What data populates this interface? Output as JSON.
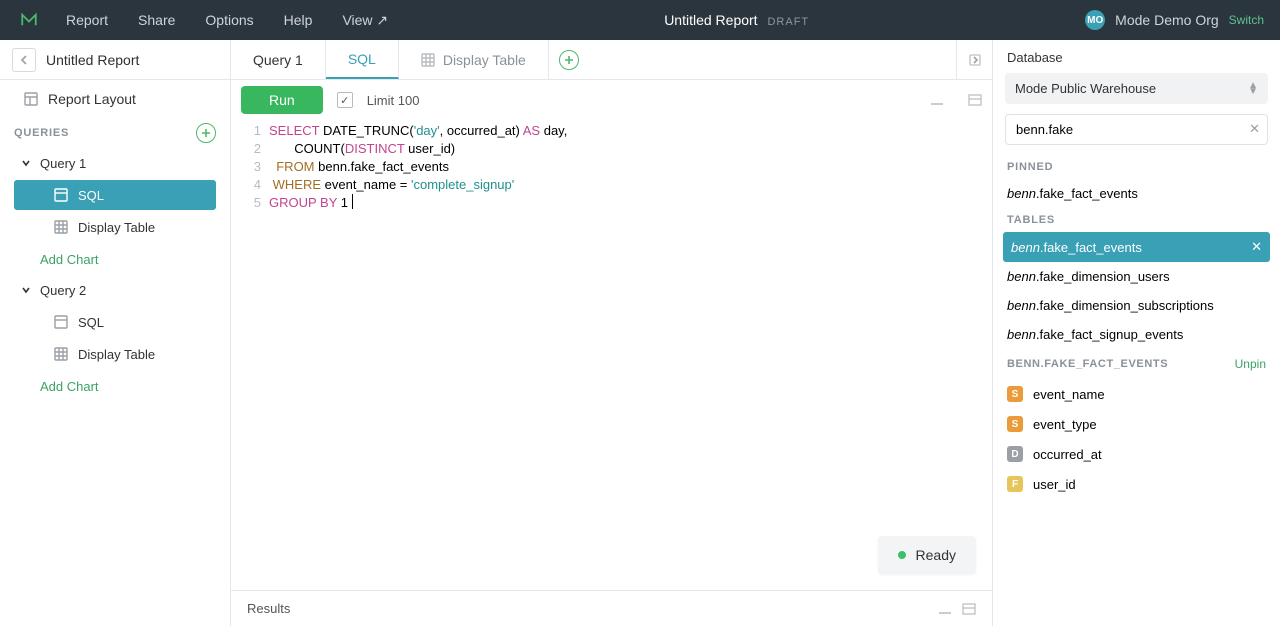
{
  "topbar": {
    "menu": [
      "Report",
      "Share",
      "Options",
      "Help",
      "View  ↗"
    ],
    "title": "Untitled Report",
    "draft": "DRAFT",
    "orgBadge": "MO",
    "orgName": "Mode Demo Org",
    "switch": "Switch"
  },
  "sidebar": {
    "title": "Untitled Report",
    "reportLayout": "Report Layout",
    "queriesLabel": "QUERIES",
    "addChart": "Add Chart",
    "queries": [
      {
        "name": "Query 1",
        "items": [
          {
            "label": "SQL",
            "selected": true
          },
          {
            "label": "Display Table",
            "selected": false
          }
        ]
      },
      {
        "name": "Query 2",
        "items": [
          {
            "label": "SQL",
            "selected": false
          },
          {
            "label": "Display Table",
            "selected": false
          }
        ]
      }
    ]
  },
  "tabs": {
    "items": [
      {
        "label": "Query 1",
        "active": false,
        "icon": false
      },
      {
        "label": "SQL",
        "active": true,
        "icon": false
      },
      {
        "label": "Display Table",
        "active": false,
        "icon": true,
        "muted": true
      }
    ]
  },
  "toolbar": {
    "run": "Run",
    "limitChecked": true,
    "limit": "Limit 100"
  },
  "editor": {
    "lines": [
      [
        {
          "t": "SELECT",
          "c": "kw-pink"
        },
        {
          "t": " DATE_TRUNC("
        },
        {
          "t": "'day'",
          "c": "kw-teal"
        },
        {
          "t": ", occurred_at) "
        },
        {
          "t": "AS",
          "c": "kw-pink"
        },
        {
          "t": " day,"
        }
      ],
      [
        {
          "t": "       COUNT("
        },
        {
          "t": "DISTINCT",
          "c": "kw-pink"
        },
        {
          "t": " user_id)"
        }
      ],
      [
        {
          "t": "  "
        },
        {
          "t": "FROM",
          "c": "kw-brown"
        },
        {
          "t": " benn.fake_fact_events"
        }
      ],
      [
        {
          "t": " "
        },
        {
          "t": "WHERE",
          "c": "kw-brown"
        },
        {
          "t": " event_name = "
        },
        {
          "t": "'complete_signup'",
          "c": "kw-teal"
        }
      ],
      [
        {
          "t": "GROUP BY",
          "c": "kw-pink"
        },
        {
          "t": " 1"
        }
      ]
    ]
  },
  "status": {
    "ready": "Ready"
  },
  "results": {
    "label": "Results"
  },
  "rightpanel": {
    "databaseLabel": "Database",
    "database": "Mode Public Warehouse",
    "search": "benn.fake",
    "pinnedLabel": "PINNED",
    "pinned": [
      {
        "schema": "benn",
        "table": "fake_fact_events"
      }
    ],
    "tablesLabel": "TABLES",
    "tables": [
      {
        "schema": "benn",
        "table": "fake_fact_events",
        "selected": true
      },
      {
        "schema": "benn",
        "table": "fake_dimension_users"
      },
      {
        "schema": "benn",
        "table": "fake_dimension_subscriptions"
      },
      {
        "schema": "benn",
        "table": "fake_fact_signup_events"
      }
    ],
    "columnsHeader": "BENN.FAKE_FACT_EVENTS",
    "unpin": "Unpin",
    "columns": [
      {
        "type": "S",
        "name": "event_name"
      },
      {
        "type": "S",
        "name": "event_type"
      },
      {
        "type": "D",
        "name": "occurred_at"
      },
      {
        "type": "F",
        "name": "user_id"
      }
    ]
  }
}
